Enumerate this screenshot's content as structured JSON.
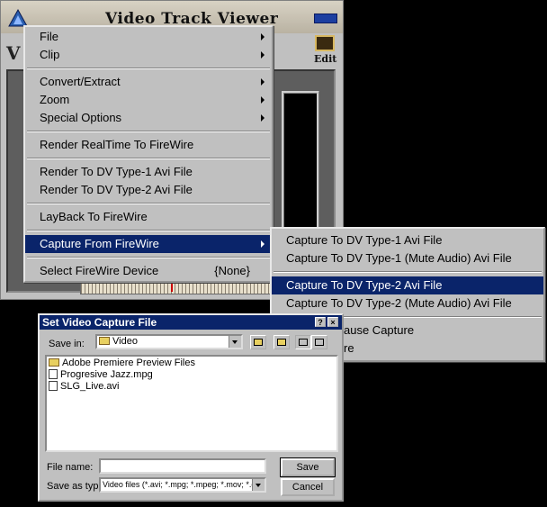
{
  "viewer": {
    "title": "Video Track Viewer",
    "edit_label": "Edit"
  },
  "main_menu": {
    "items": [
      {
        "label": "File"
      },
      {
        "label": "Clip"
      },
      {
        "label": "Convert/Extract"
      },
      {
        "label": "Zoom"
      },
      {
        "label": "Special Options"
      },
      {
        "label": "Render RealTime To FireWire"
      },
      {
        "label": "Render To DV Type-1 Avi File"
      },
      {
        "label": "Render To DV Type-2 Avi File"
      },
      {
        "label": "LayBack To FireWire"
      },
      {
        "label": "Capture From FireWire"
      },
      {
        "label": "Select FireWire Device",
        "shortcut": "{None}"
      }
    ]
  },
  "capture_submenu": {
    "items": [
      {
        "label": "Capture To DV Type-1 Avi File"
      },
      {
        "label": "Capture To DV Type-1 (Mute Audio) Avi File"
      },
      {
        "label": "Capture To DV Type-2 Avi File"
      },
      {
        "label": "Capture To DV Type-2 (Mute Audio) Avi File"
      },
      {
        "label": "ause Capture"
      },
      {
        "label": "re"
      }
    ]
  },
  "dialog": {
    "title": "Set Video Capture File",
    "help_btn": "?",
    "close_btn": "×",
    "save_in_label": "Save in:",
    "save_in_value": "Video",
    "files": [
      {
        "name": "Adobe Premiere Preview Files",
        "icon": "folder-icon"
      },
      {
        "name": "Progresive Jazz.mpg",
        "icon": "mpg-file-icon"
      },
      {
        "name": "SLG_Live.avi",
        "icon": "avi-file-icon"
      }
    ],
    "filename_label": "File name:",
    "filename_value": "",
    "save_type_label": "Save as type:",
    "save_type_value": "Video files (*.avi; *.mpg; *.mpeg; *.mov; *.qt)",
    "save_button": "Save",
    "cancel_button": "Cancel"
  }
}
